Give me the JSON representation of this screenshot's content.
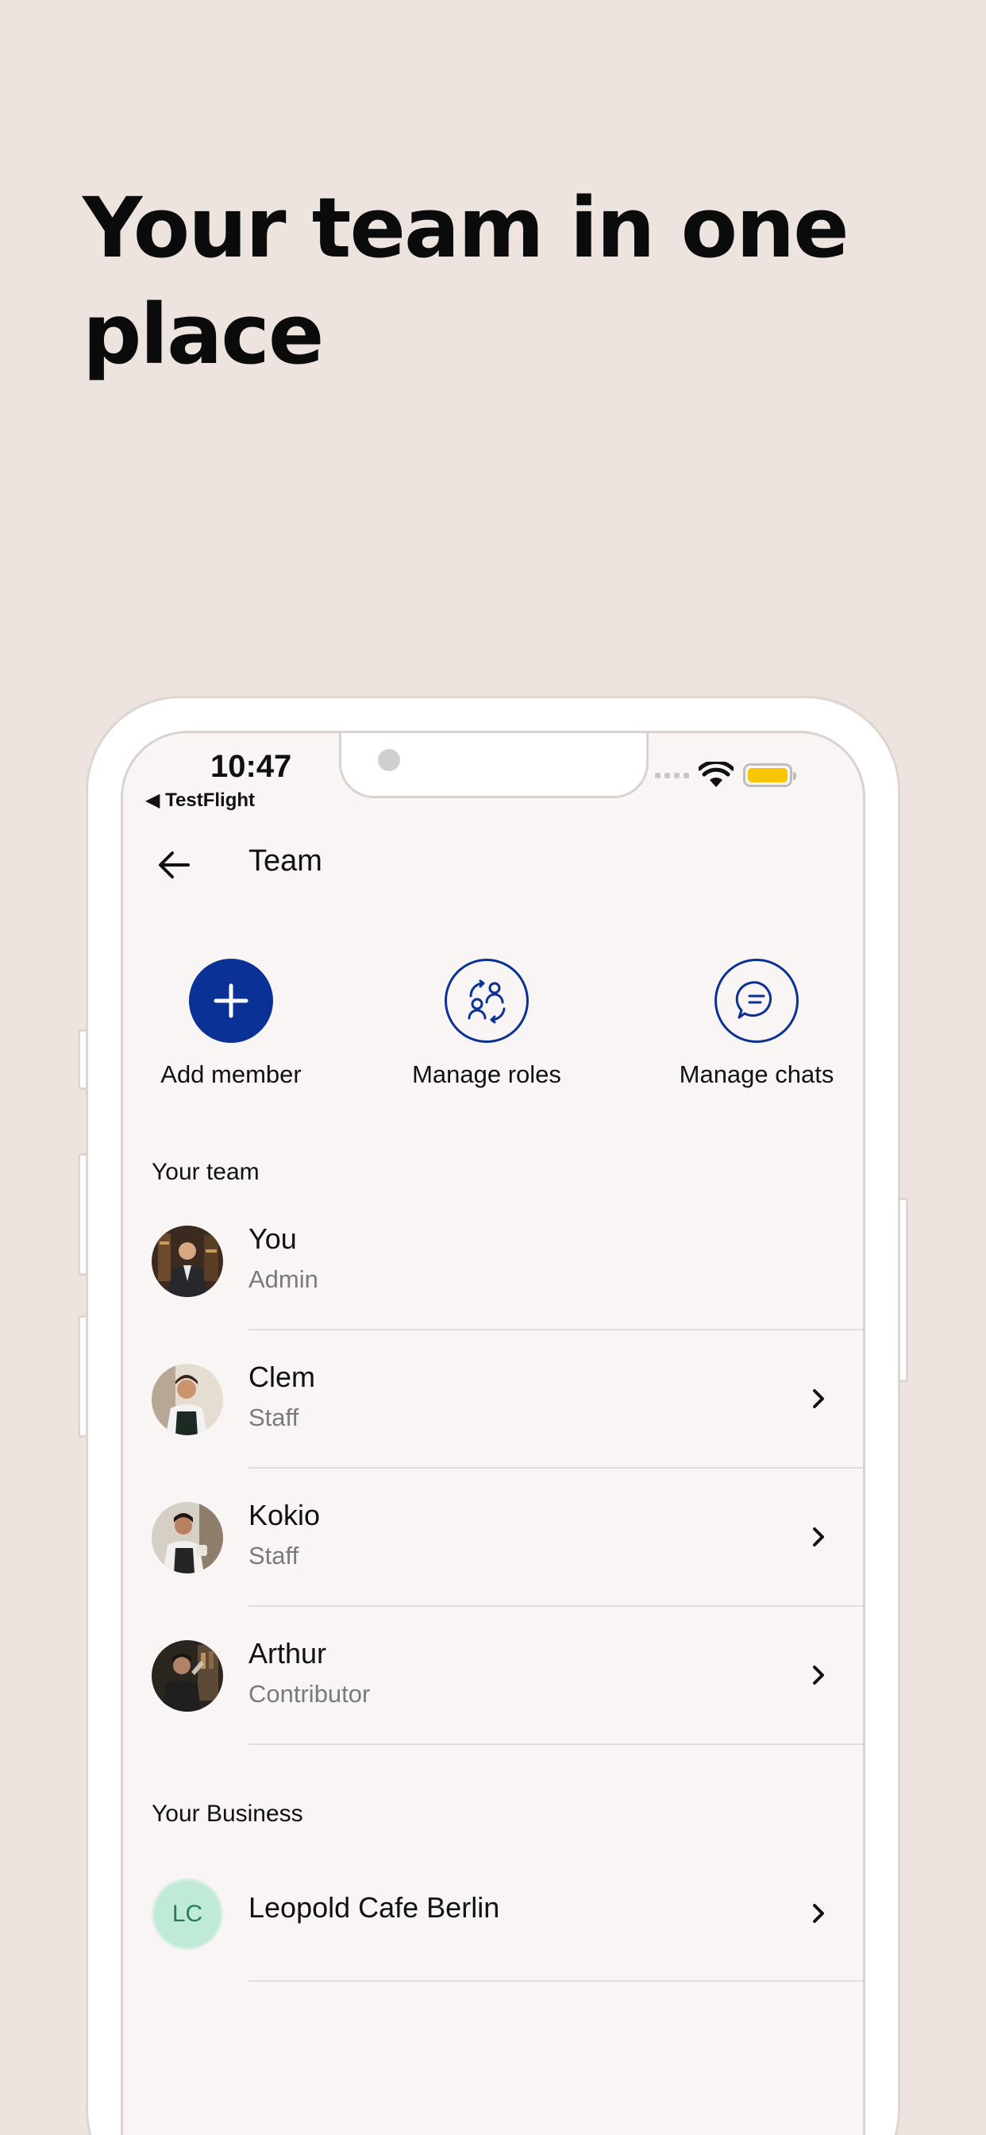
{
  "headline": "Your team in one place",
  "status_bar": {
    "time": "10:47",
    "back_app": "◀ TestFlight"
  },
  "nav": {
    "title": "Team"
  },
  "actions": [
    {
      "label": "Add member",
      "icon": "plus-icon"
    },
    {
      "label": "Manage roles",
      "icon": "swap-users-icon"
    },
    {
      "label": "Manage chats",
      "icon": "chat-bubble-icon"
    }
  ],
  "team_section": {
    "title": "Your team",
    "members": [
      {
        "name": "You",
        "role": "Admin",
        "avatar": "man-in-suit-photo"
      },
      {
        "name": "Clem",
        "role": "Staff",
        "avatar": "woman-with-apron-photo"
      },
      {
        "name": "Kokio",
        "role": "Staff",
        "avatar": "barista-photo"
      },
      {
        "name": "Arthur",
        "role": "Contributor",
        "avatar": "bartender-photo"
      }
    ]
  },
  "business_section": {
    "title": "Your Business",
    "business": {
      "initials": "LC",
      "name": "Leopold Cafe Berlin"
    }
  },
  "colors": {
    "background": "#ede3df",
    "screen": "#f9f5f4",
    "accent": "#0a3296",
    "battery": "#f7c600",
    "initials_bg": "#bfead6"
  }
}
